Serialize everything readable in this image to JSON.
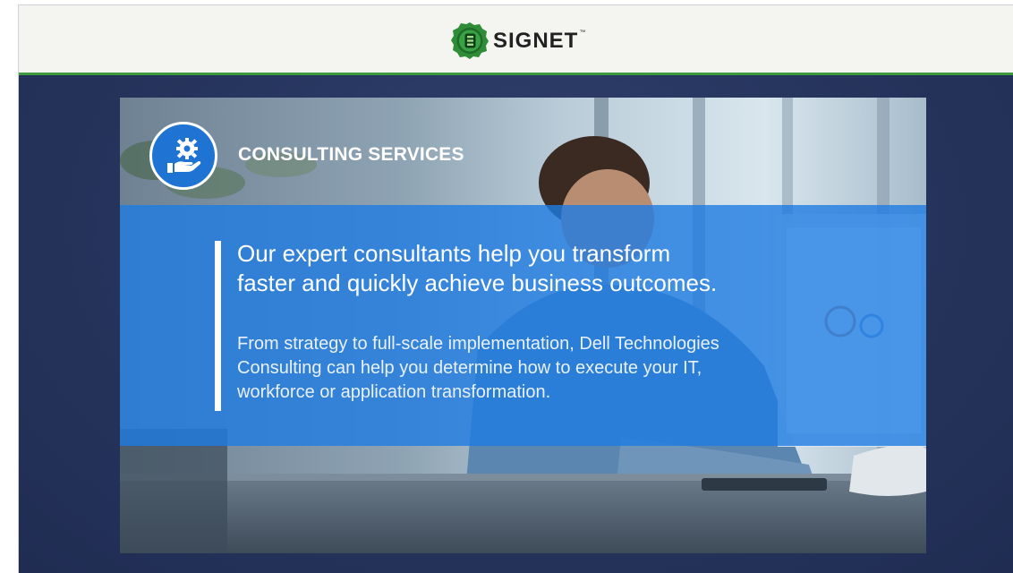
{
  "header": {
    "brand_name": "SIGNET",
    "brand_tm": "™",
    "logo_icon": "signet-seal-icon",
    "accent_color": "#3d9a3f"
  },
  "slide": {
    "section_icon": "hand-gear-icon",
    "section_title": "CONSULTING SERVICES",
    "headline_line1": "Our expert consultants help you transform",
    "headline_line2": "faster and quickly achieve business outcomes.",
    "body_line1": "From strategy to full-scale implementation, Dell Technologies",
    "body_line2": "Consulting can help you determine how to execute your IT,",
    "body_line3": "workforce or application transformation.",
    "band_color": "#1e7ce2",
    "background_color": "#27365f"
  }
}
